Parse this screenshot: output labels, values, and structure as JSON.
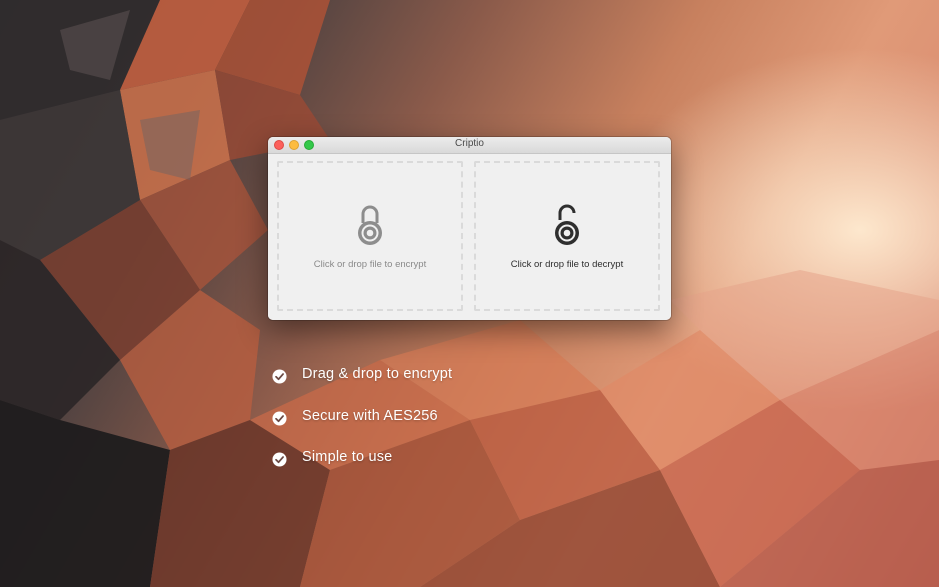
{
  "window": {
    "title": "Criptio"
  },
  "drop_zones": {
    "encrypt": {
      "label": "Click or drop file to encrypt",
      "icon": "lock-closed-icon"
    },
    "decrypt": {
      "label": "Click or drop file to decrypt",
      "icon": "lock-open-icon"
    }
  },
  "features": [
    {
      "label": "Drag & drop to encrypt",
      "icon": "check-circle-icon"
    },
    {
      "label": "Secure with AES256",
      "icon": "check-circle-icon"
    },
    {
      "label": "Simple to use",
      "icon": "check-circle-icon"
    }
  ],
  "colors": {
    "close": "#fc605b",
    "minimize": "#fdbc40",
    "zoom": "#34c84a"
  }
}
